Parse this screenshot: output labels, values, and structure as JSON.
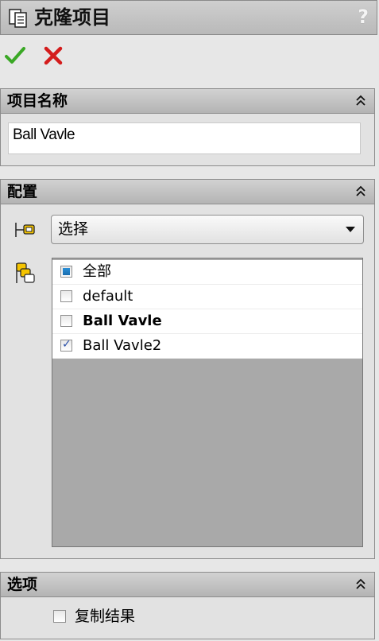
{
  "window": {
    "title": "克隆项目",
    "help_label": "?"
  },
  "actions": {
    "ok_icon": "checkmark-icon",
    "cancel_icon": "x-icon",
    "ok_color": "#3aa825",
    "cancel_color": "#d41c1c"
  },
  "sections": {
    "name": {
      "label": "项目名称",
      "value": "Ball Vavle"
    },
    "config": {
      "label": "配置",
      "select_value": "选择",
      "items": [
        {
          "label": "全部",
          "state": "partial",
          "bold": false
        },
        {
          "label": "default",
          "state": "unchecked",
          "bold": false
        },
        {
          "label": "Ball Vavle",
          "state": "unchecked",
          "bold": true
        },
        {
          "label": "Ball Vavle2",
          "state": "checked",
          "bold": false
        }
      ]
    },
    "options": {
      "label": "选项",
      "copy_result_label": "复制结果",
      "copy_result_checked": false
    }
  }
}
